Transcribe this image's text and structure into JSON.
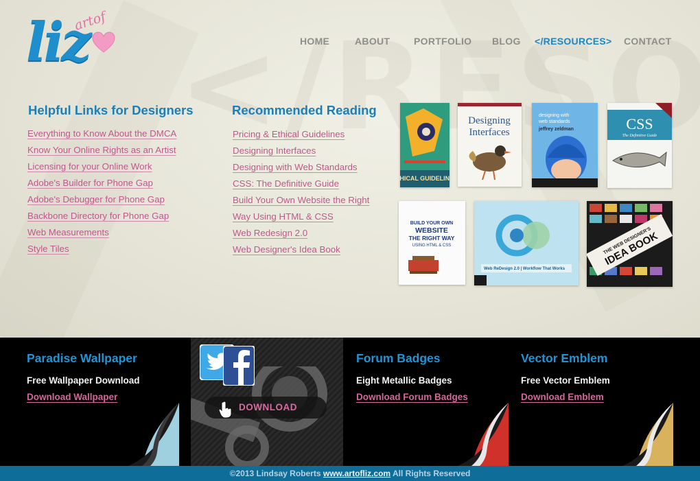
{
  "logo": {
    "main": "liz",
    "small": "artof",
    "heart_icon": "heart-icon"
  },
  "background_word": "</RESOU",
  "nav": {
    "items": [
      {
        "label": "HOME",
        "active": false
      },
      {
        "label": "ABOUT",
        "active": false
      },
      {
        "label": "PORTFOLIO",
        "active": false
      },
      {
        "label": "BLOG",
        "active": false
      },
      {
        "label": "</RESOURCES>",
        "active": true
      },
      {
        "label": "CONTACT",
        "active": false
      }
    ]
  },
  "helpful_links": {
    "title": "Helpful Links for Designers",
    "items": [
      "Everything to Know About the DMCA",
      "Know Your Online Rights as an Artist",
      "Licensing for your Online Work",
      "Adobe's Builder for Phone Gap",
      "Adobe's Debugger for Phone Gap",
      "Backbone Directory for Phone Gap",
      "Web Measurements",
      "Style Tiles"
    ]
  },
  "reading": {
    "title": "Recommended Reading",
    "items": [
      "Pricing & Ethical Guidelines",
      "Designing Interfaces",
      "Designing with Web Standards",
      "CSS: The Definitive Guide",
      "Build Your Own Website the Right",
      "Way Using HTML & CSS",
      "Web Redesign 2.0",
      "Web Designer's Idea Book"
    ]
  },
  "books": [
    {
      "title": "Pricing & Ethical Guidelines",
      "cover_text": "ETHICAL GUIDELINES"
    },
    {
      "title": "Designing Interfaces",
      "cover_text": "Designing Interfaces"
    },
    {
      "title": "Designing with Web Standards",
      "cover_text": "designing with web standards",
      "author": "jeffrey zeldman"
    },
    {
      "title": "CSS: The Definitive Guide",
      "cover_text": "CSS",
      "subtitle": "The Definitive Guide"
    },
    {
      "title": "Build Your Own Website the Right Way",
      "cover_text": "BUILD YOUR OWN WEBSITE THE RIGHT WAY",
      "subtitle": "USING HTML & CSS"
    },
    {
      "title": "Web Redesign 2.0",
      "cover_text": "Web ReDesign 2.0 | Workflow That Works"
    },
    {
      "title": "Web Designer's Idea Book",
      "cover_text": "THE WEB DESIGNER'S IDEA BOOK"
    }
  ],
  "promos": [
    {
      "title": "Paradise Wallpaper",
      "subtitle": "Free Wallpaper Download",
      "link": "Download Wallpaper"
    },
    {
      "title": "Forum Badges",
      "subtitle": "Eight Metallic Badges",
      "link": "Download Forum Badges"
    },
    {
      "title": "Vector Emblem",
      "subtitle": "Free Vector Emblem",
      "link": "Download Emblem"
    }
  ],
  "social": {
    "download_label": "DOWNLOAD",
    "icons": [
      "twitter-icon",
      "facebook-icon",
      "steam-icon",
      "hand-cursor-icon"
    ]
  },
  "footer": {
    "prefix": "©2013 Lindsay Roberts",
    "link": "www.artofliz.com",
    "suffix": "All Rights Reserved"
  },
  "colors": {
    "accent_blue": "#1d88c4",
    "link_pink": "#c0588d",
    "footer_blue": "#0f6d99"
  }
}
